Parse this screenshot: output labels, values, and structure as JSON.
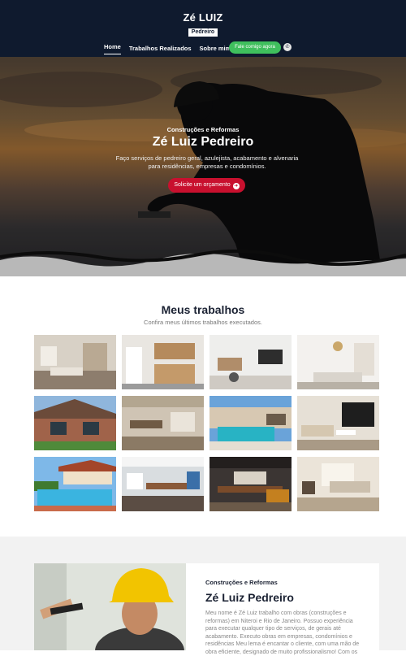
{
  "header": {
    "logo_title": "Zé LUIZ",
    "logo_subtitle": "Pedreiro",
    "nav": [
      {
        "label": "Home",
        "active": true
      },
      {
        "label": "Trabalhos Realizados",
        "active": false
      },
      {
        "label": "Sobre mim",
        "active": false
      }
    ],
    "cta_label": "Fale comigo agora",
    "whatsapp_icon": "whatsapp-icon",
    "colors": {
      "background": "#0f1a2e",
      "cta": "#3fbf5d"
    }
  },
  "hero": {
    "kicker": "Construções e Reformas",
    "title": "Zé Luiz Pedreiro",
    "description": "Faço serviços de pedreiro geral, azulejista, acabamento e alvenaria para residências, empresas e condomínios.",
    "button_label": "Solicite um orçamento",
    "button_icon": "arrow-right-icon",
    "colors": {
      "button": "#c8102e"
    }
  },
  "works": {
    "title": "Meus trabalhos",
    "subtitle": "Confira meus últimos trabalhos executados.",
    "photos": [
      "living-room-photo",
      "kitchen-photo",
      "open-living-kitchen-photo",
      "white-living-room-photo",
      "brick-house-exterior-photo",
      "gourmet-area-photo",
      "pool-area-photo",
      "modern-living-room-photo",
      "house-with-pool-photo",
      "office-meeting-room-photo",
      "restaurant-interior-photo",
      "loft-living-room-photo"
    ]
  },
  "about": {
    "kicker": "Construções e Reformas",
    "title": "Zé Luiz Pedreiro",
    "text": "Meu nome é Zé Luiz trabalho com obras (construções e reformas) em Niteroi e Rio de Janeiro. Possuo experiência para executar qualquer tipo de serviços, de gerais até acabamento. Executo obras em empresas, condomínios e residências Meu lema é encantar o cliente, com uma mão de obra eficiente, designado de muito profissionalismo! Com os"
  }
}
